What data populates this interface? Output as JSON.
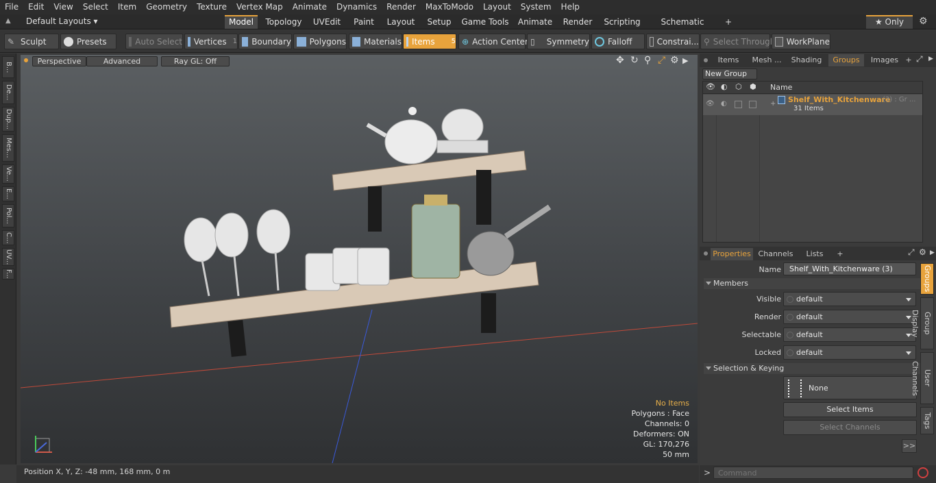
{
  "menu": [
    "File",
    "Edit",
    "View",
    "Select",
    "Item",
    "Geometry",
    "Texture",
    "Vertex Map",
    "Animate",
    "Dynamics",
    "Render",
    "MaxToModo",
    "Layout",
    "System",
    "Help"
  ],
  "layouts": {
    "label": "Default Layouts ▾"
  },
  "mode_tabs": [
    "Model",
    "Topology",
    "UVEdit",
    "Paint",
    "Layout",
    "Setup",
    "Game Tools",
    "Animate",
    "Render",
    "Scripting",
    "Schematic Fusion",
    "+"
  ],
  "only": {
    "label": "★ Only"
  },
  "toolbar": {
    "sculpt": "Sculpt",
    "presets": "Presets",
    "auto_select": "Auto Select",
    "vertices": "Vertices",
    "vertices_count": "1",
    "boundary": "Boundary",
    "polygons": "Polygons",
    "materials": "Materials",
    "items": "Items",
    "items_count": "5",
    "action_center": "Action Center",
    "symmetry": "Symmetry",
    "falloff": "Falloff",
    "constraints": "Constrai...",
    "select_through": "Select Through",
    "workplane": "WorkPlane"
  },
  "left_tabs": [
    "B...",
    "De...",
    "Dup...",
    "Mes...",
    "Ve...",
    "E...",
    "Pol...",
    "C...",
    "UV...",
    "F..."
  ],
  "viewport": {
    "perspective": "Perspective",
    "advanced": "Advanced",
    "raygl": "Ray GL: Off",
    "stats": {
      "items": "No Items",
      "polygons": "Polygons : Face",
      "channels": "Channels: 0",
      "deformers": "Deformers: ON",
      "gl": "GL: 170,276",
      "scale": "50 mm"
    }
  },
  "top_panel": {
    "tabs": [
      "Items",
      "Mesh ...",
      "Shading",
      "Groups",
      "Images",
      "+"
    ],
    "new_group": "New Group",
    "col_name": "Name",
    "group_name": "Shelf_With_Kitchenware",
    "group_suffix": "(3) : Gr ...",
    "group_count": "31 Items"
  },
  "properties": {
    "tabs": [
      "Properties",
      "Channels",
      "Lists",
      "+"
    ],
    "name_label": "Name",
    "name_value": "Shelf_With_Kitchenware (3)",
    "members_section": "Members",
    "rows": [
      {
        "label": "Visible",
        "value": "default"
      },
      {
        "label": "Render",
        "value": "default"
      },
      {
        "label": "Selectable",
        "value": "default"
      },
      {
        "label": "Locked",
        "value": "default"
      }
    ],
    "sel_section": "Selection & Keying",
    "none": "None",
    "select_items": "Select Items",
    "select_channels": "Select Channels",
    "more": ">>",
    "side_tabs": [
      "Groups",
      "Group Display",
      "User Channels",
      "Tags"
    ]
  },
  "status": {
    "position": "Position X, Y, Z:  -48 mm, 168 mm, 0 m"
  },
  "command": {
    "placeholder": "Command",
    "prompt": ">"
  }
}
